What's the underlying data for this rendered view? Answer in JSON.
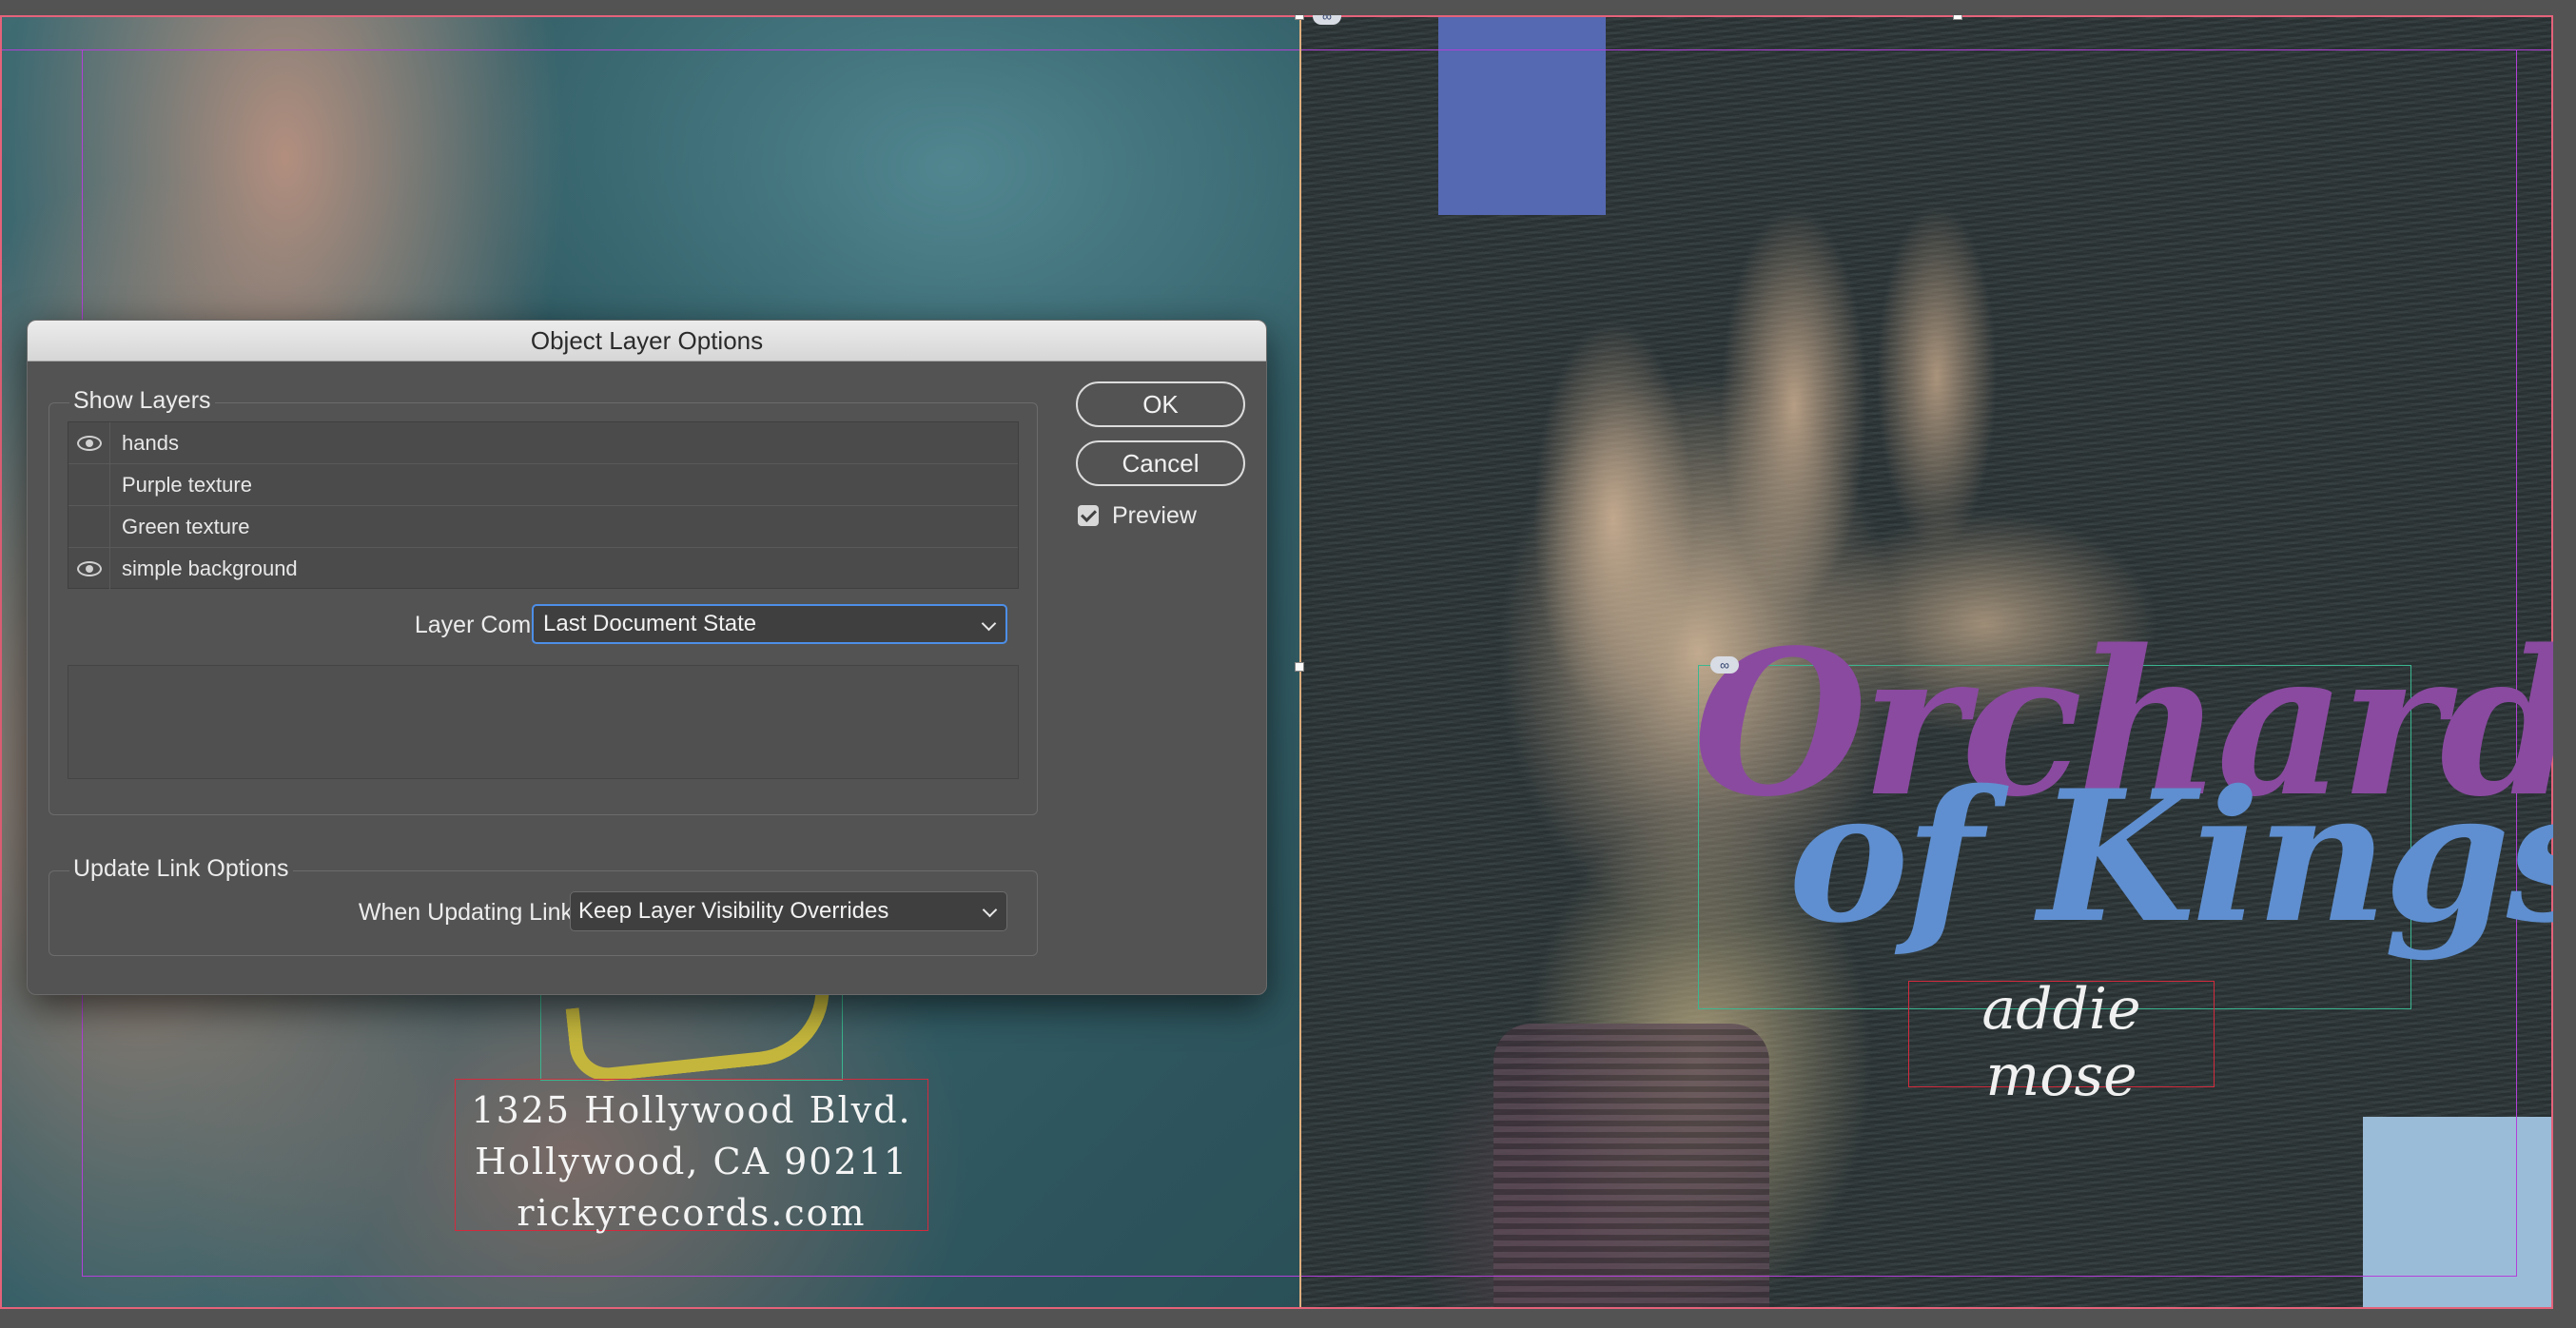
{
  "dialog": {
    "title": "Object Layer Options",
    "show_layers_label": "Show Layers",
    "layers": [
      {
        "name": "hands",
        "visible": true
      },
      {
        "name": "Purple texture",
        "visible": false
      },
      {
        "name": "Green texture",
        "visible": false
      },
      {
        "name": "simple background",
        "visible": true
      }
    ],
    "layer_comp_label": "Layer Comp:",
    "layer_comp_value": "Last Document State",
    "update_link_options_label": "Update Link Options",
    "when_updating_label": "When Updating Link:",
    "when_updating_value": "Keep Layer Visibility Overrides",
    "ok_label": "OK",
    "cancel_label": "Cancel",
    "preview_label": "Preview",
    "preview_checked": true
  },
  "document": {
    "title_line1": "Orchard",
    "title_line2": "of Kings",
    "artist": "addie mose",
    "address_line1": "1325 Hollywood Blvd.",
    "address_line2": "Hollywood, CA 90211",
    "website": "rickyrecords.com",
    "link_icon_glyph": "∞"
  },
  "colors": {
    "title_purple": "#8a4aa0",
    "title_blue": "#5f8fd0",
    "focus_blue": "#4d8fe8",
    "margin_guide": "#b240d8",
    "frame_red": "#d42a3d",
    "frame_green": "#3bb68f"
  }
}
